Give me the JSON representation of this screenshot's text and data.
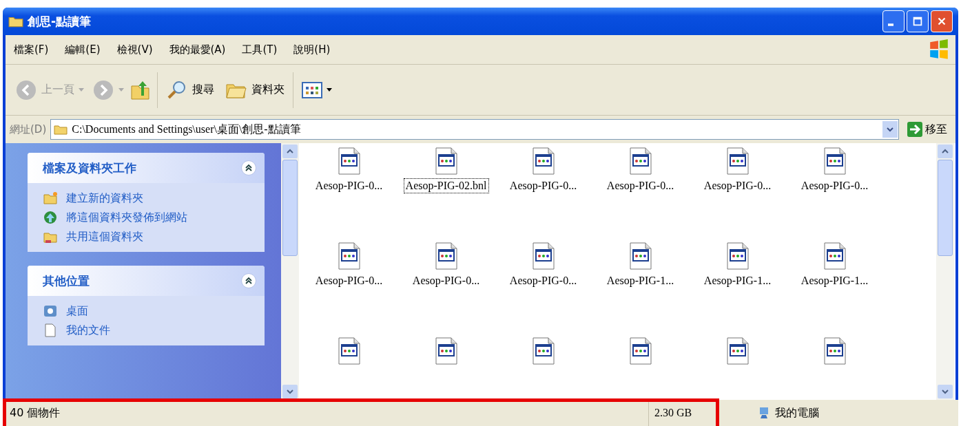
{
  "window": {
    "title": "創思-點讀筆"
  },
  "menu": [
    "檔案(F)",
    "編輯(E)",
    "檢視(V)",
    "我的最愛(A)",
    "工具(T)",
    "說明(H)"
  ],
  "toolbar": {
    "back": "上一頁",
    "search": "搜尋",
    "folders": "資料夾"
  },
  "address": {
    "label": "網址(D)",
    "value": "C:\\Documents and Settings\\user\\桌面\\創思-點讀筆",
    "go": "移至"
  },
  "sidebar": [
    {
      "title": "檔案及資料夾工作",
      "expanded": true,
      "items": [
        {
          "kind": "new-folder",
          "label": "建立新的資料夾"
        },
        {
          "kind": "globe",
          "label": "將這個資料夾發佈到網站"
        },
        {
          "kind": "share",
          "label": "共用這個資料夾"
        }
      ]
    },
    {
      "title": "其他位置",
      "expanded": true,
      "items": [
        {
          "kind": "desktop",
          "label": "桌面"
        },
        {
          "kind": "documents",
          "label": "我的文件"
        }
      ]
    }
  ],
  "files": [
    {
      "label": "Aesop-PIG-0...",
      "selected": false
    },
    {
      "label": "Aesop-PIG-02.bnl",
      "selected": true
    },
    {
      "label": "Aesop-PIG-0...",
      "selected": false
    },
    {
      "label": "Aesop-PIG-0...",
      "selected": false
    },
    {
      "label": "Aesop-PIG-0...",
      "selected": false
    },
    {
      "label": "Aesop-PIG-0...",
      "selected": false
    },
    {
      "label": "Aesop-PIG-0...",
      "selected": false
    },
    {
      "label": "Aesop-PIG-0...",
      "selected": false
    },
    {
      "label": "Aesop-PIG-0...",
      "selected": false
    },
    {
      "label": "Aesop-PIG-1...",
      "selected": false
    },
    {
      "label": "Aesop-PIG-1...",
      "selected": false
    },
    {
      "label": "Aesop-PIG-1...",
      "selected": false
    },
    {
      "selected": false
    },
    {
      "selected": false
    },
    {
      "selected": false
    },
    {
      "selected": false
    },
    {
      "selected": false
    },
    {
      "selected": false
    }
  ],
  "status_bar": {
    "count": "40 個物件",
    "size": "2.30 GB",
    "location": "我的電腦"
  }
}
